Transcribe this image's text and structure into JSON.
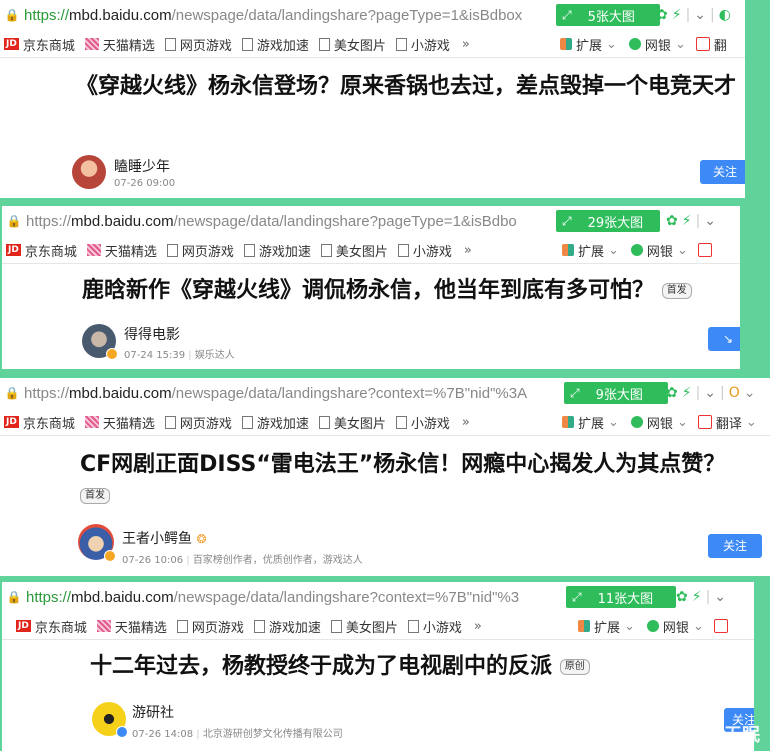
{
  "bookmarks": [
    "京东商城",
    "天猫精选",
    "网页游戏",
    "游戏加速",
    "美女图片",
    "小游戏"
  ],
  "bookmarks_more": "»",
  "ext_label": "扩展",
  "bank_label": "网银",
  "translate_label": "翻译",
  "translate_short": "翻",
  "follow_label": "关注",
  "card1": {
    "url": {
      "scheme": "https://",
      "host": "mbd.baidu.com",
      "path": "/newspage/data/landingshare?pageType=1&isBdbox"
    },
    "images": "5张大图",
    "title": "《穿越火线》杨永信登场？原来香锅也去过，差点毁掉一个电竞天才",
    "author": "瞌睡少年",
    "date": "07-26 09:00"
  },
  "card2": {
    "url": {
      "scheme": "https://",
      "host": "mbd.baidu.com",
      "path": "/newspage/data/landingshare?pageType=1&isBdbo"
    },
    "images": "29张大图",
    "title": "鹿晗新作《穿越火线》调侃杨永信，他当年到底有多可怕？",
    "tag": "首发",
    "author": "得得电影",
    "date": "07-24 15:39",
    "role": "娱乐达人"
  },
  "card3": {
    "url": {
      "scheme": "https://",
      "host": "mbd.baidu.com",
      "path": "/newspage/data/landingshare?context=%7B\"nid\"%3A"
    },
    "images": "9张大图",
    "title": "CF网剧正面DISS“雷电法王”杨永信！网瘾中心揭发人为其点赞？",
    "tag": "首发",
    "author": "王者小鳄鱼",
    "date": "07-26 10:06",
    "role": "百家榜创作者，优质创作者，游戏达人"
  },
  "card4": {
    "url": {
      "scheme": "https://",
      "host": "mbd.baidu.com",
      "path": "/newspage/data/landingshare?context=%7B\"nid\"%3"
    },
    "images": "11张大图",
    "title": "十二年过去，杨教授终于成为了电视剧中的反派",
    "tag": "原创",
    "author": "游研社",
    "date": "07-26 14:08",
    "role": "北京游研创梦文化传播有限公司"
  },
  "watermark": "诤言无眠",
  "colors": {
    "green_pill": "#2fbd5b",
    "follow": "#3d8af7",
    "background": "#5fd39a"
  }
}
